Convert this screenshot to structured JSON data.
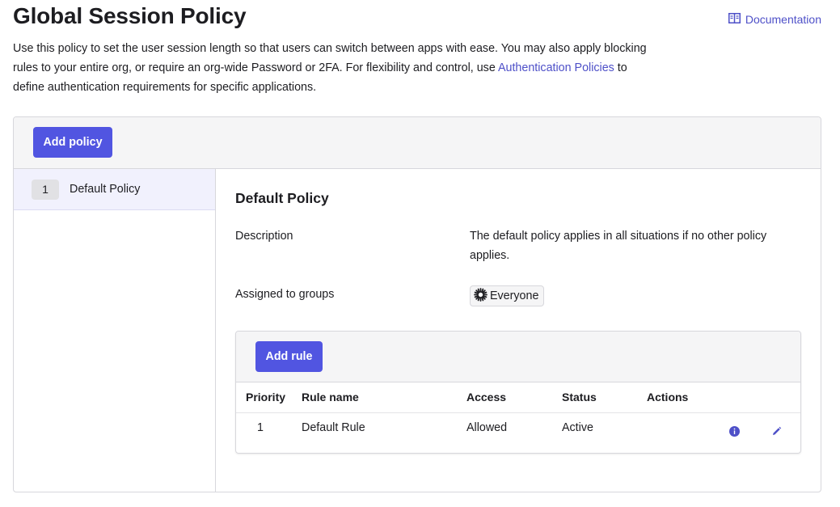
{
  "header": {
    "title": "Global Session Policy",
    "documentation_label": "Documentation",
    "intro_text": "Use this policy to set the user session length so that users can switch between apps with ease. You may also apply blocking rules to your entire org, or require an org-wide Password or 2FA. For flexibility and control, use ",
    "intro_link": "Authentication Policies",
    "intro_suffix": " to define authentication requirements for specific applications."
  },
  "policies": {
    "add_button_label": "Add policy",
    "items": [
      {
        "priority": "1",
        "name": "Default Policy"
      }
    ]
  },
  "detail": {
    "title": "Default Policy",
    "description_label": "Description",
    "description_value": "The default policy applies in all situations if no other policy applies.",
    "groups_label": "Assigned to groups",
    "groups": [
      "Everyone"
    ]
  },
  "rules": {
    "add_button_label": "Add rule",
    "columns": [
      "Priority",
      "Rule name",
      "Access",
      "Status",
      "Actions"
    ],
    "rows": [
      {
        "priority": "1",
        "name": "Default Rule",
        "access": "Allowed",
        "status": "Active"
      }
    ]
  },
  "icons": {
    "documentation": "book-icon",
    "group": "sunburst-group-icon",
    "info": "info-icon",
    "edit": "pencil-icon"
  },
  "colors": {
    "accent": "#5155e1",
    "link": "#4e50c8",
    "header_bg": "#f5f5f6",
    "selected_bg": "#f1f1fd"
  }
}
